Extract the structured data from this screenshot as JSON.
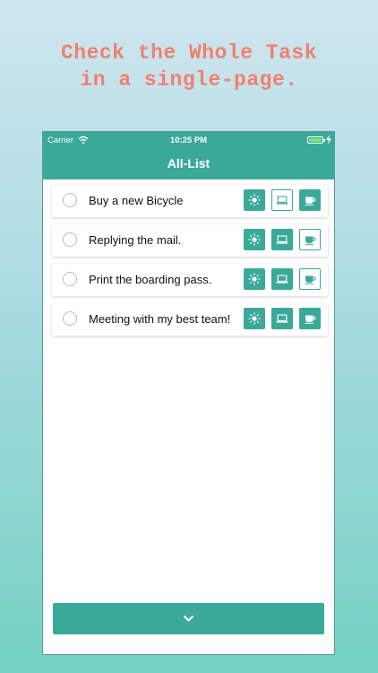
{
  "promo": {
    "line1": "Check the Whole Task",
    "line2": "in a single-page."
  },
  "status_bar": {
    "carrier": "Carrier",
    "time": "10:25 PM"
  },
  "nav": {
    "title": "All-List"
  },
  "tasks": [
    {
      "label": "Buy a new Bicycle",
      "tags": {
        "sun": true,
        "laptop": false,
        "cup": true
      }
    },
    {
      "label": "Replying the mail.",
      "tags": {
        "sun": true,
        "laptop": true,
        "cup": false
      }
    },
    {
      "label": "Print the boarding pass.",
      "tags": {
        "sun": true,
        "laptop": true,
        "cup": false
      }
    },
    {
      "label": "Meeting with my best team!",
      "tags": {
        "sun": true,
        "laptop": true,
        "cup": true
      }
    }
  ],
  "icons": {
    "tag1": "sun-icon",
    "tag2": "laptop-icon",
    "tag3": "coffee-cup-icon",
    "bottom": "chevron-down-icon"
  },
  "colors": {
    "accent": "#3aa99a",
    "headline": "#f0806f",
    "battery": "#7ee36f"
  }
}
